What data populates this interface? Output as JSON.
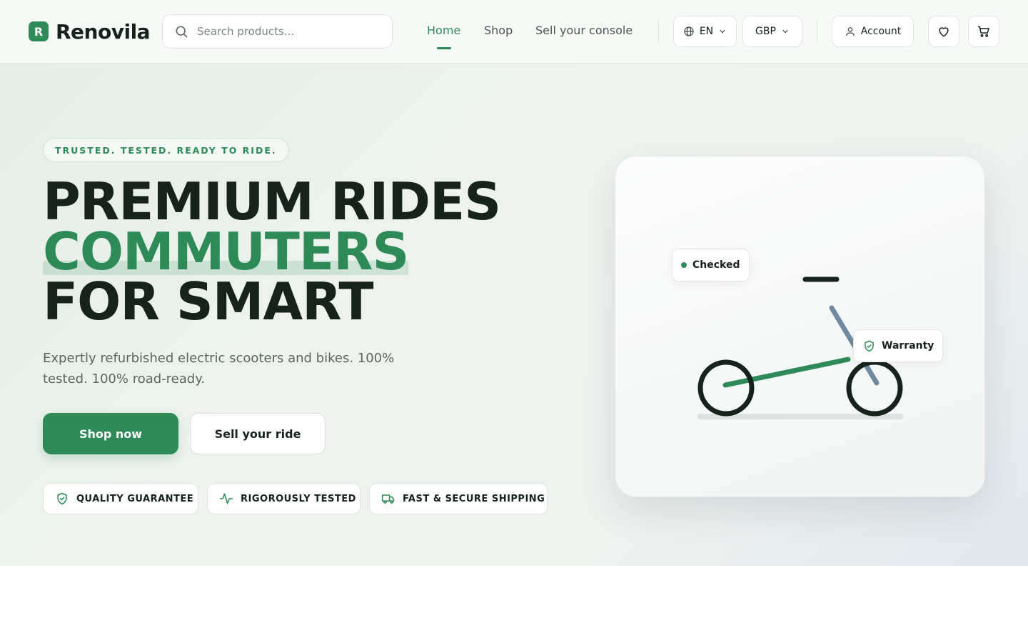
{
  "brand": {
    "mark": "R",
    "name": "Renovila"
  },
  "search": {
    "placeholder": "Search products..."
  },
  "nav": {
    "home": "Home",
    "shop": "Shop",
    "sell": "Sell your console",
    "active": "Home"
  },
  "controls": {
    "language": "EN",
    "currency": "GBP",
    "account": "Account"
  },
  "icons": [
    "search-icon",
    "globe-icon",
    "chevron-down-icon",
    "user-icon",
    "heart-icon",
    "cart-icon",
    "shield-check-icon",
    "activity-icon",
    "truck-icon"
  ],
  "hero": {
    "eyebrow": "TRUSTED. TESTED. READY TO RIDE.",
    "headline_line1": "PREMIUM RIDES",
    "headline_line2": "COMMUTERS",
    "headline_line3": "FOR SMART",
    "subtitle": "Expertly refurbished electric scooters and bikes. 100% tested. 100% road-ready.",
    "primary_cta": "Shop now",
    "secondary_cta": "Sell your ride",
    "badges": [
      "QUALITY GUARANTEE",
      "RIGOROUSLY TESTED",
      "FAST & SECURE SHIPPING"
    ],
    "card_tags": {
      "checked": "Checked",
      "warranty": "Warranty"
    }
  },
  "colors": {
    "accent": "#2e8b57",
    "text": "#16221c",
    "muted": "#5b655f",
    "steel": "#6f8aa0"
  }
}
